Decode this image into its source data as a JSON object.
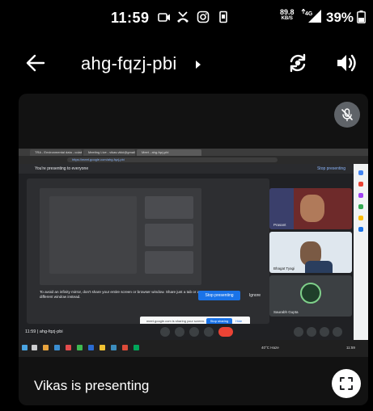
{
  "status_bar": {
    "time": "11:59",
    "net_speed": "89.8",
    "net_unit": "KB/S",
    "network": "4G",
    "battery": "39%"
  },
  "app_bar": {
    "meeting_code": "ahg-fqzj-pbi",
    "icons": [
      "back-arrow-icon",
      "caret-right-icon",
      "switch-camera-icon",
      "volume-icon"
    ]
  },
  "stage": {
    "presenter_label": "Vikas is presenting",
    "mute_icon": "mic-off-icon",
    "fullscreen_icon": "fullscreen-icon"
  },
  "shared_screen": {
    "tabs": [
      "TRA - Environmental data - colab",
      "Meeting Live - vikas.vikki@gmail",
      "Meet - ahg-fqzj-pbi"
    ],
    "url": "https://meet.google.com/ahg-fqzj-pbi",
    "presenting_banner": "You're presenting to everyone",
    "stop_presenting_link": "Stop presenting",
    "infinity_warning": "To avoid an infinity mirror, don't share your entire screen or browser window. Share just a tab or a different window instead.",
    "stop_presenting_button": "Stop presenting",
    "ignore_button": "Ignore",
    "tiles": [
      "Prasant",
      "Bhagat Tyagi",
      "Saurabh Gupta"
    ],
    "meet_time_code": "11:59 | ahg-fqzj-pbi",
    "share_popup_text": "meet.google.com is sharing your screen.",
    "share_popup_stop": "Stop sharing",
    "share_popup_hide": "Hide",
    "taskbar_weather": "40°C Haze",
    "taskbar_time": "11:59"
  },
  "colors": {
    "accent_blue": "#1a73e8",
    "hangup_red": "#ea4335",
    "card_bg": "#121212"
  }
}
